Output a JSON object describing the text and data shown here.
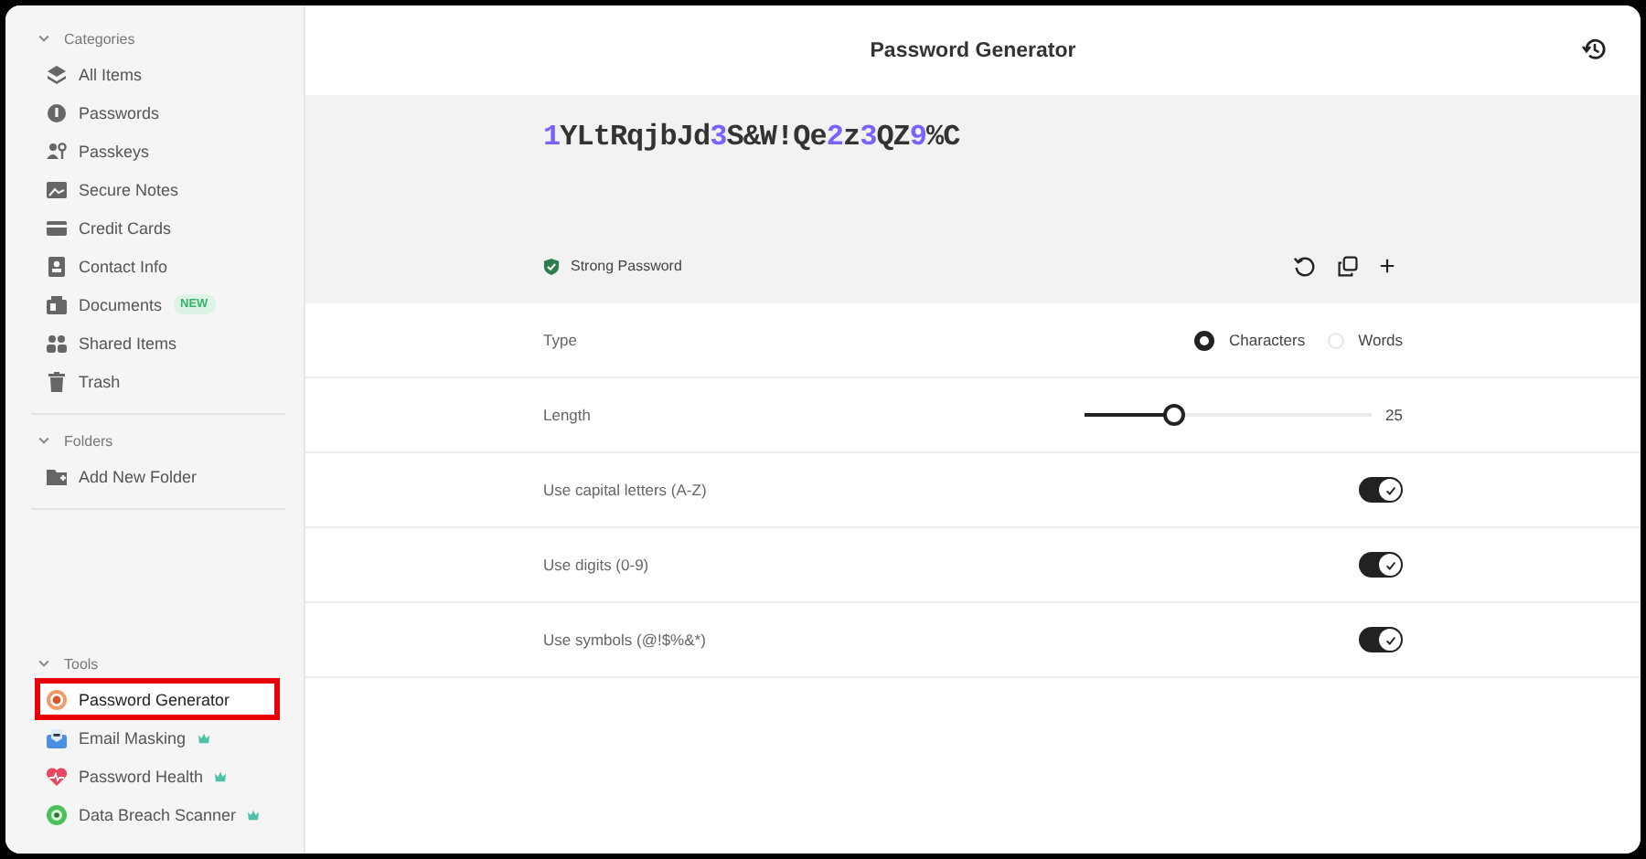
{
  "sidebar": {
    "sections": [
      {
        "title": "Categories",
        "expanded": true,
        "items": [
          {
            "label": "All Items",
            "selected": false
          },
          {
            "label": "Passwords",
            "selected": false
          },
          {
            "label": "Passkeys",
            "selected": false
          },
          {
            "label": "Secure Notes",
            "selected": false
          },
          {
            "label": "Credit Cards",
            "selected": false
          },
          {
            "label": "Contact Info",
            "selected": false
          },
          {
            "label": "Documents",
            "badge": "NEW",
            "selected": false
          },
          {
            "label": "Shared Items",
            "selected": false
          },
          {
            "label": "Trash",
            "selected": false
          }
        ]
      },
      {
        "title": "Folders",
        "expanded": true,
        "items": [
          {
            "label": "Add New Folder",
            "selected": false
          }
        ]
      },
      {
        "title": "Tools",
        "expanded": true,
        "items": [
          {
            "label": "Password Generator",
            "selected": true,
            "highlighted": true
          },
          {
            "label": "Email Masking",
            "premium": true,
            "selected": false
          },
          {
            "label": "Password Health",
            "premium": true,
            "selected": false
          },
          {
            "label": "Data Breach Scanner",
            "premium": true,
            "selected": false
          }
        ]
      }
    ]
  },
  "header": {
    "title": "Password Generator"
  },
  "generator": {
    "password": "1YLtRqjbJd3S&W!Qe2z3QZ9%C",
    "strength": "Strong Password"
  },
  "options": [
    {
      "kind": "radio",
      "label": "Type",
      "choices": [
        {
          "label": "Characters",
          "selected": true
        },
        {
          "label": "Words",
          "selected": false
        }
      ]
    },
    {
      "kind": "slider",
      "label": "Length",
      "level": 0.31,
      "reading": "25"
    },
    {
      "kind": "toggle",
      "label": "Use capital letters (A-Z)",
      "on": true
    },
    {
      "kind": "toggle",
      "label": "Use digits (0-9)",
      "on": true
    },
    {
      "kind": "toggle",
      "label": "Use symbols (@!$%&*)",
      "on": true
    }
  ]
}
